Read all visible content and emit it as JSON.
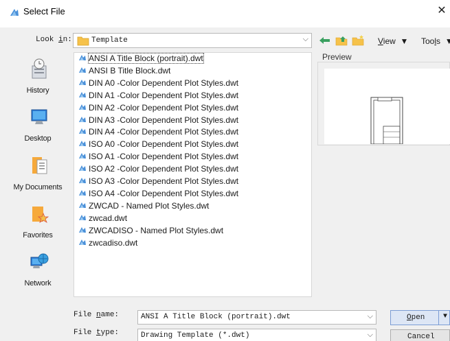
{
  "window": {
    "title": "Select File",
    "close_glyph": "✕"
  },
  "toolbar": {
    "look_in_label": "Look in:",
    "look_in_value": "Template",
    "view_label": "View",
    "tools_label": "Tools",
    "menu_arrow": "▼",
    "combo_arrow": "⌵"
  },
  "places": [
    {
      "label": "History",
      "icon": "history-icon"
    },
    {
      "label": "Desktop",
      "icon": "desktop-icon"
    },
    {
      "label": "My Documents",
      "icon": "documents-icon"
    },
    {
      "label": "Favorites",
      "icon": "favorites-icon"
    },
    {
      "label": "Network",
      "icon": "network-icon"
    }
  ],
  "files": [
    "ANSI A Title Block (portrait).dwt",
    "ANSI B Title Block.dwt",
    "DIN A0 -Color Dependent Plot Styles.dwt",
    "DIN A1 -Color Dependent Plot Styles.dwt",
    "DIN A2 -Color Dependent Plot Styles.dwt",
    "DIN A3 -Color Dependent Plot Styles.dwt",
    "DIN A4 -Color Dependent Plot Styles.dwt",
    "ISO A0 -Color Dependent Plot Styles.dwt",
    "ISO A1 -Color Dependent Plot Styles.dwt",
    "ISO A2 -Color Dependent Plot Styles.dwt",
    "ISO A3 -Color Dependent Plot Styles.dwt",
    "ISO A4 -Color Dependent Plot Styles.dwt",
    "ZWCAD - Named Plot Styles.dwt",
    "zwcad.dwt",
    "ZWCADISO - Named Plot Styles.dwt",
    "zwcadiso.dwt"
  ],
  "selected_file_index": 0,
  "preview": {
    "label": "Preview"
  },
  "file_name": {
    "label": "File name:",
    "value": "ANSI A Title Block (portrait).dwt"
  },
  "file_type": {
    "label": "File type:",
    "value": "Drawing Template (*.dwt)"
  },
  "buttons": {
    "open": "Open",
    "cancel": "Cancel",
    "open_dropdown": "▼"
  },
  "colors": {
    "accent": "#4a90d9",
    "dialog_bg": "#f0f0f0",
    "folder": "#f6c24a"
  }
}
